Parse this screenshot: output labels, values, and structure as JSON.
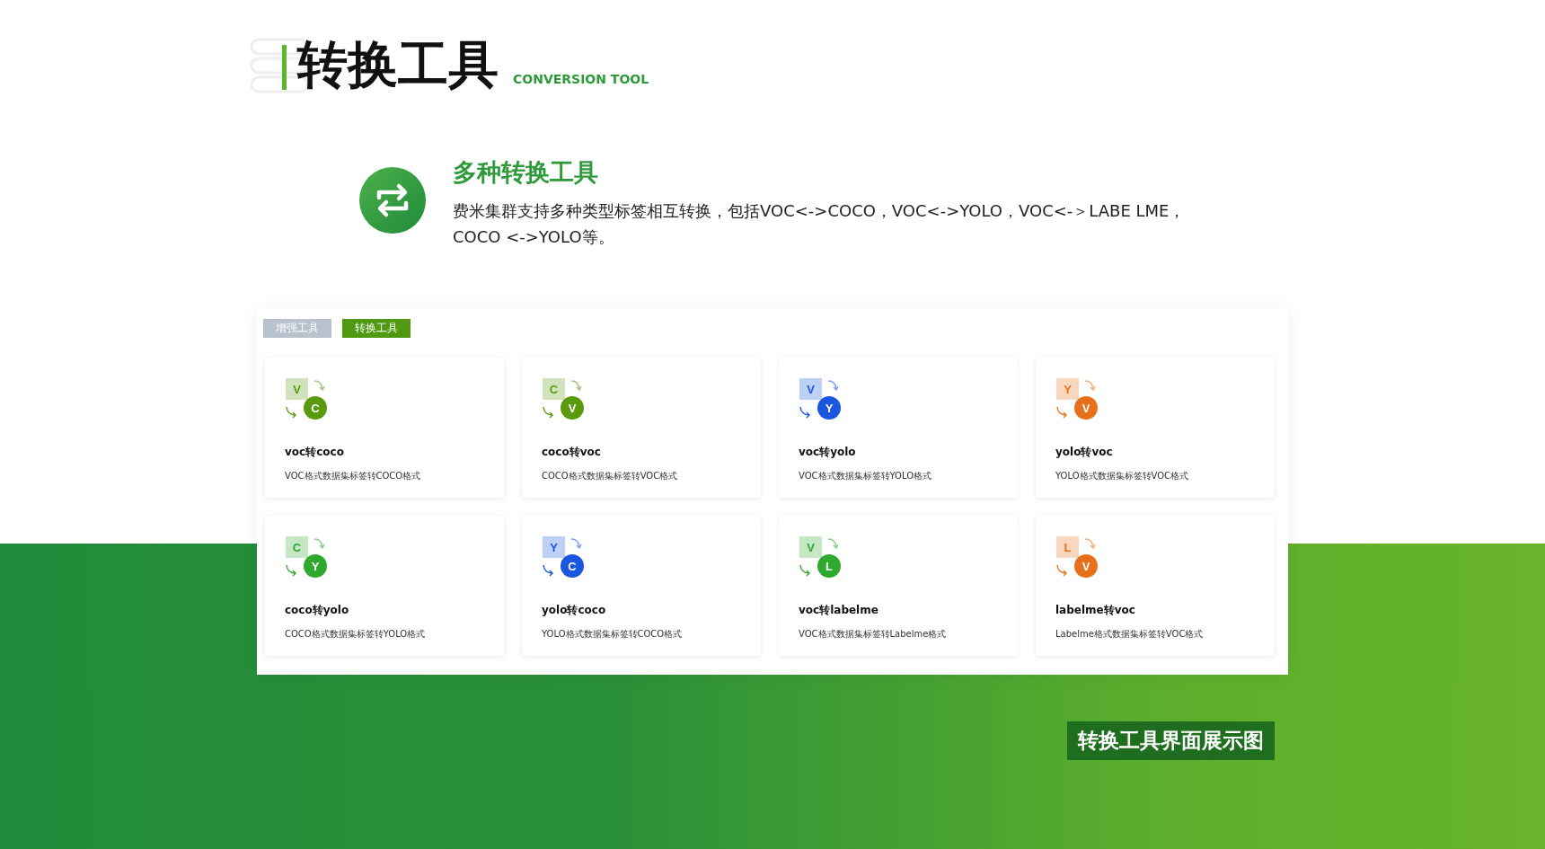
{
  "header": {
    "title": "转换工具",
    "subtitle": "CONVERSION TOOL"
  },
  "feature": {
    "title": "多种转换工具",
    "description": "费米集群支持多种类型标签相互转换，包括VOC<->COCO，VOC<->YOLO，VOC<-＞LABE LME，COCO <->YOLO等。"
  },
  "tabs": [
    {
      "label": "增强工具",
      "selected": false
    },
    {
      "label": "转换工具",
      "selected": true
    }
  ],
  "cards": [
    {
      "from": "V",
      "to": "C",
      "color": "#5a9a0e",
      "title": "voc转coco",
      "description": "VOC格式数据集标签转COCO格式"
    },
    {
      "from": "C",
      "to": "V",
      "color": "#5a9a0e",
      "title": "coco转voc",
      "description": "COCO格式数据集标签转VOC格式"
    },
    {
      "from": "V",
      "to": "Y",
      "color": "#1a56e0",
      "title": "voc转yolo",
      "description": "VOC格式数据集标签转YOLO格式"
    },
    {
      "from": "Y",
      "to": "V",
      "color": "#e8701a",
      "title": "yolo转voc",
      "description": "YOLO格式数据集标签转VOC格式"
    },
    {
      "from": "C",
      "to": "Y",
      "color": "#2ea82e",
      "title": "coco转yolo",
      "description": "COCO格式数据集标签转YOLO格式"
    },
    {
      "from": "Y",
      "to": "C",
      "color": "#1a56e0",
      "title": "yolo转coco",
      "description": "YOLO格式数据集标签转COCO格式"
    },
    {
      "from": "V",
      "to": "L",
      "color": "#2ea82e",
      "title": "voc转labelme",
      "description": "VOC格式数据集标签转Labelme格式"
    },
    {
      "from": "L",
      "to": "V",
      "color": "#e8701a",
      "title": "labelme转voc",
      "description": "Labelme格式数据集标签转VOC格式"
    }
  ],
  "caption": "转换工具界面展示图"
}
